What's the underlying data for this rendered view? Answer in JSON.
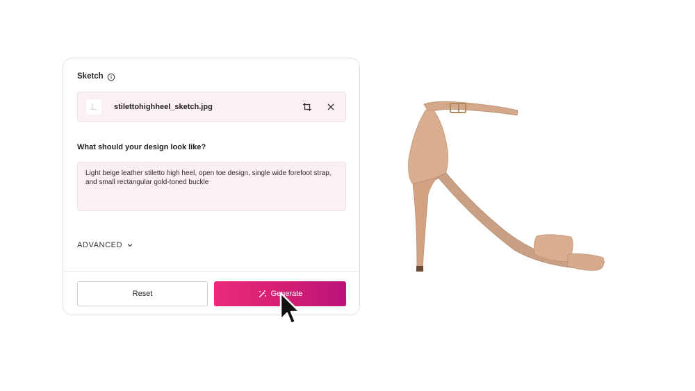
{
  "sketch": {
    "label": "Sketch",
    "info_icon": "info-icon",
    "file_name": "stilettohighheel_sketch.jpg",
    "crop_icon": "crop-icon",
    "remove_icon": "close-icon"
  },
  "design": {
    "question": "What should your design look like?",
    "prompt": "Light beige leather stiletto high heel, open toe design, single wide forefoot strap, and small rectangular gold-toned buckle"
  },
  "advanced": {
    "label": "ADVANCED",
    "icon": "chevron-down-icon"
  },
  "actions": {
    "reset_label": "Reset",
    "generate_label": "Generate",
    "generate_icon": "magic-wand-icon"
  },
  "colors": {
    "accent_start": "#ea2a7a",
    "accent_end": "#b9137a",
    "field_bg": "#fbf1f3",
    "shoe": "#d8ae8e"
  },
  "result_image": "generated-shoe-image"
}
